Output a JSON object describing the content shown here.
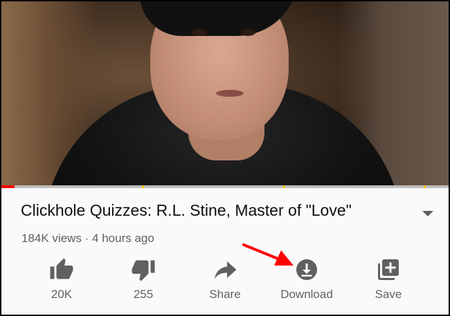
{
  "video": {
    "progress_fraction": 0.03,
    "marker_fractions": [
      0.315,
      0.63,
      0.945
    ]
  },
  "title": "Clickhole Quizzes: R.L. Stine, Master of \"Love\"",
  "meta": "184K views · 4 hours ago",
  "actions": [
    {
      "label": "20K",
      "icon": "thumbs-up-icon"
    },
    {
      "label": "255",
      "icon": "thumbs-down-icon"
    },
    {
      "label": "Share",
      "icon": "share-icon"
    },
    {
      "label": "Download",
      "icon": "download-icon"
    },
    {
      "label": "Save",
      "icon": "save-to-playlist-icon"
    }
  ],
  "colors": {
    "progress_played": "#ff0000",
    "progress_buffer": "#bdbdbd",
    "chapter_marker": "#f9c800",
    "icon": "#606060",
    "annotation_arrow": "#ff0000"
  }
}
